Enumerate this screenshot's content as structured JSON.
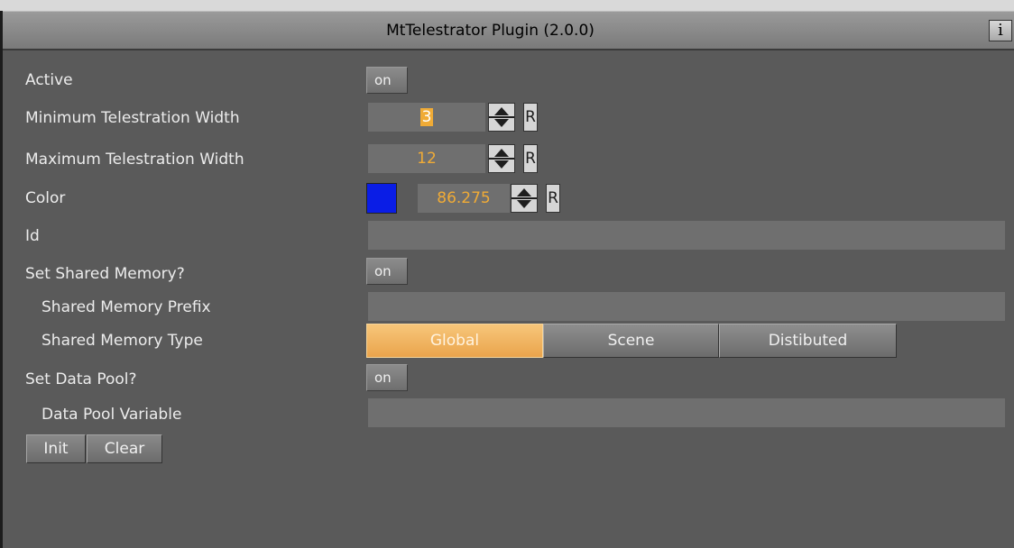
{
  "plugin": {
    "title": "MtTelestrator Plugin (2.0.0)",
    "info_label": "i"
  },
  "fields": {
    "active": {
      "label": "Active",
      "toggle": "on"
    },
    "min_width": {
      "label": "Minimum Telestration Width",
      "value": "3",
      "reset": "R"
    },
    "max_width": {
      "label": "Maximum Telestration Width",
      "value": "12",
      "reset": "R"
    },
    "color": {
      "label": "Color",
      "value": "86.275",
      "reset": "R",
      "swatch": "#0a1de6"
    },
    "id": {
      "label": "Id",
      "value": ""
    },
    "set_shared_memory": {
      "label": "Set Shared Memory?",
      "toggle": "on"
    },
    "shared_memory_prefix": {
      "label": "Shared Memory Prefix",
      "value": ""
    },
    "shared_memory_type": {
      "label": "Shared Memory Type",
      "options": [
        "Global",
        "Scene",
        "Distibuted"
      ],
      "selected": "Global"
    },
    "set_data_pool": {
      "label": "Set Data Pool?",
      "toggle": "on"
    },
    "data_pool_variable": {
      "label": "Data Pool Variable",
      "value": ""
    }
  },
  "actions": {
    "init": "Init",
    "clear": "Clear"
  },
  "colors": {
    "accent": "#f0ab36",
    "panel": "#5a5a5a",
    "field": "#6f6f6f"
  }
}
